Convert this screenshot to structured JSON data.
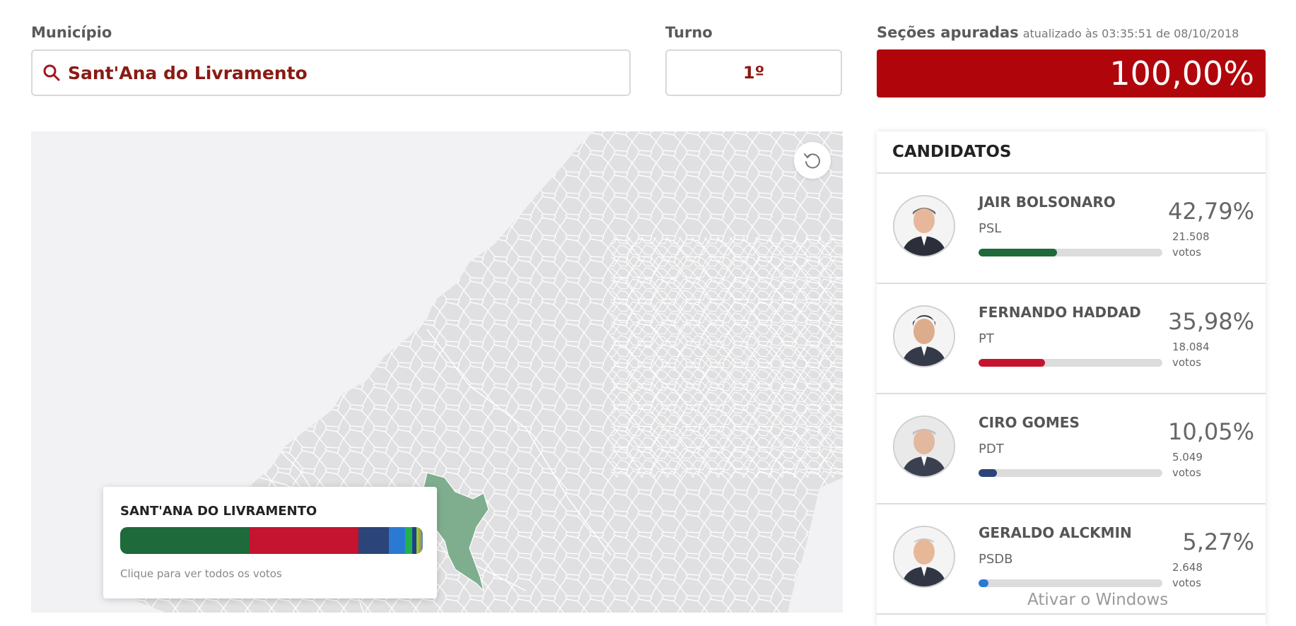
{
  "municipio": {
    "label": "Município",
    "value": "Sant'Ana do Livramento",
    "icon": "search-icon"
  },
  "turno": {
    "label": "Turno",
    "value": "1º"
  },
  "secoes": {
    "label": "Seções apuradas",
    "updated": "atualizado às 03:35:51 de 08/10/2018",
    "value": "100,00%",
    "fraction": 1.0
  },
  "map": {
    "reset_icon": "reset-icon",
    "highlight_color": "#7fae8e",
    "popup": {
      "title": "SANT'ANA DO LIVRAMENTO",
      "hint": "Clique para ver todos os votos",
      "segments": [
        {
          "share": 42.79,
          "color": "#1e6a3a"
        },
        {
          "share": 35.98,
          "color": "#c4142f"
        },
        {
          "share": 10.05,
          "color": "#2b4479"
        },
        {
          "share": 5.27,
          "color": "#2a7ad3"
        },
        {
          "share": 2.5,
          "color": "#22b14c"
        },
        {
          "share": 1.2,
          "color": "#1f3f8a"
        },
        {
          "share": 0.9,
          "color": "#8ccf3a"
        },
        {
          "share": 0.7,
          "color": "#b5a128"
        },
        {
          "share": 0.6,
          "color": "#6a8cc4"
        }
      ]
    }
  },
  "candidatos": {
    "header": "CANDIDATOS",
    "items": [
      {
        "name": "JAIR BOLSONARO",
        "party": "PSL",
        "pct": "42,79%",
        "votes": "21.508",
        "votes_label": "votos",
        "share": 0.4279,
        "color": "#1e6a3a"
      },
      {
        "name": "FERNANDO HADDAD",
        "party": "PT",
        "pct": "35,98%",
        "votes": "18.084",
        "votes_label": "votos",
        "share": 0.3598,
        "color": "#c4142f"
      },
      {
        "name": "CIRO GOMES",
        "party": "PDT",
        "pct": "10,05%",
        "votes": "5.049",
        "votes_label": "votos",
        "share": 0.1005,
        "color": "#2b4479"
      },
      {
        "name": "GERALDO ALCKMIN",
        "party": "PSDB",
        "pct": "5,27%",
        "votes": "2.648",
        "votes_label": "votos",
        "share": 0.0527,
        "color": "#2a7ad3"
      }
    ]
  },
  "watermark": "Ativar o Windows"
}
